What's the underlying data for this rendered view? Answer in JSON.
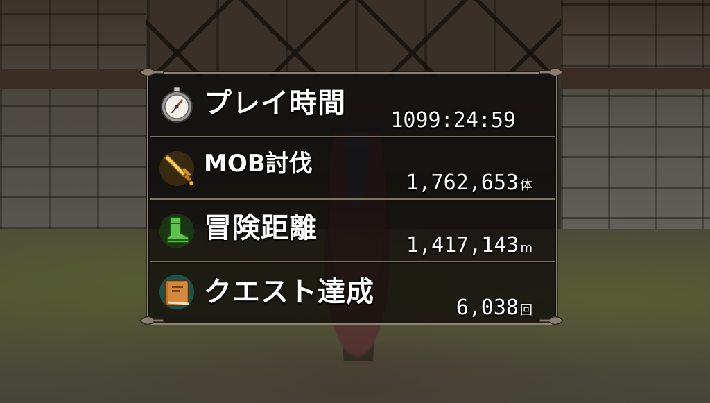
{
  "stats": [
    {
      "label": "プレイ時間",
      "value": "1099:24:59",
      "unit": "",
      "icon": "stopwatch-icon"
    },
    {
      "label": "MOB討伐",
      "value": "1,762,653",
      "unit": "体",
      "icon": "sword-icon"
    },
    {
      "label": "冒険距離",
      "value": "1,417,143",
      "unit": "m",
      "icon": "boot-icon"
    },
    {
      "label": "クエスト達成",
      "value": "6,038",
      "unit": "回",
      "icon": "book-icon"
    }
  ],
  "colors": {
    "panel_background": "#0e0c0a",
    "panel_border": "#8e8476",
    "text": "#ffffff",
    "sword_gold": "#e8b44a",
    "boot_green": "#4cae3c",
    "book_teal": "#38c8c0"
  }
}
